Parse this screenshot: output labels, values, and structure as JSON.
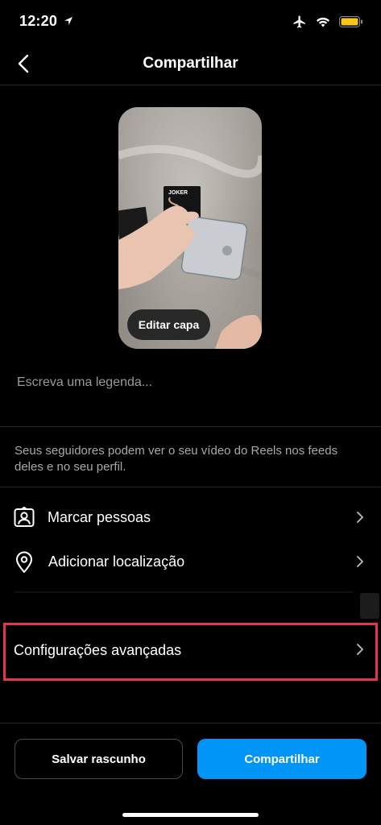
{
  "status_bar": {
    "time": "12:20"
  },
  "nav": {
    "title": "Compartilhar"
  },
  "preview": {
    "edit_cover_label": "Editar capa",
    "card_text": "JOKER"
  },
  "caption": {
    "placeholder": "Escreva uma legenda..."
  },
  "info_text": "Seus seguidores podem ver o seu vídeo do Reels nos feeds deles e no seu perfil.",
  "options": {
    "tag_people": "Marcar pessoas",
    "add_location": "Adicionar localização",
    "advanced_settings": "Configurações avançadas"
  },
  "actions": {
    "save_draft": "Salvar rascunho",
    "share": "Compartilhar"
  },
  "colors": {
    "accent": "#0095f6",
    "highlight": "#e8344b",
    "battery": "#f5c518"
  }
}
